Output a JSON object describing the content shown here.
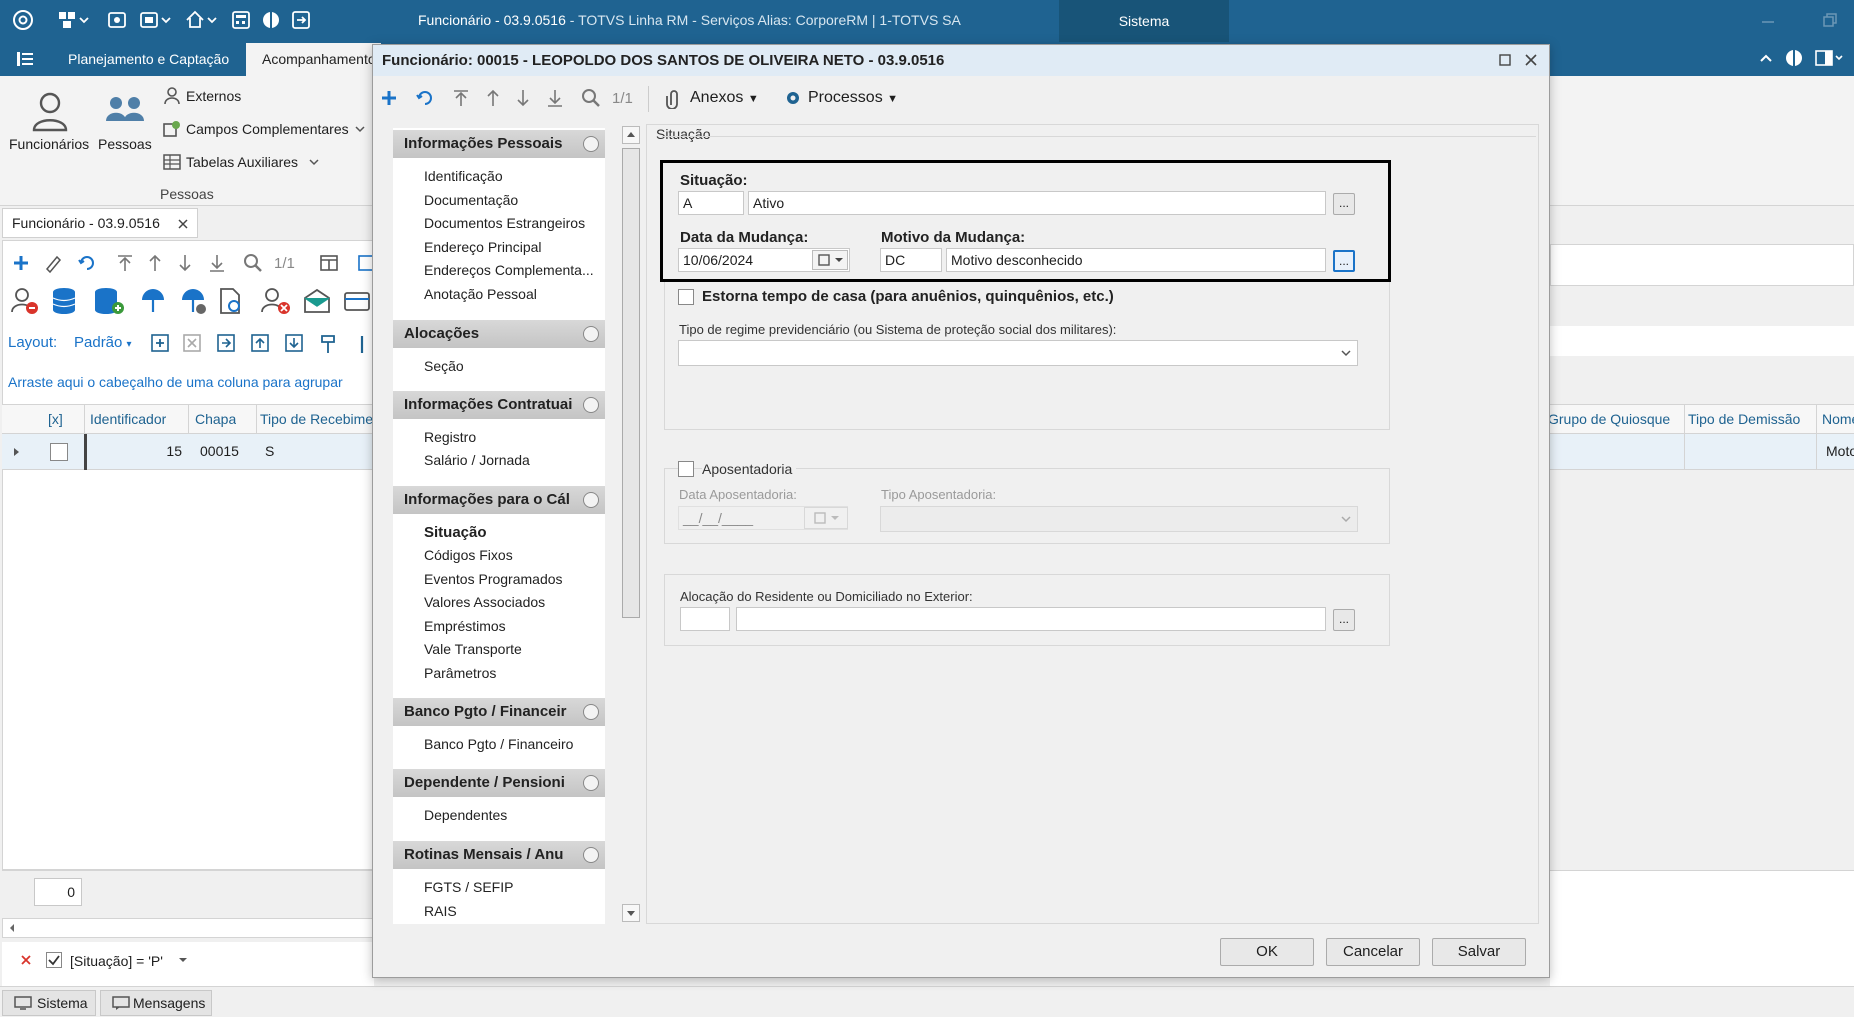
{
  "window": {
    "title_main": "Funcionário - 03.9.0516",
    "title_rest": " - TOTVS Linha RM - Serviços  Alias: CorporeRM | 1-TOTVS SA",
    "sistema_tab": "Sistema"
  },
  "menu": {
    "tabs": [
      "Planejamento e Captação",
      "Acompanhamento"
    ]
  },
  "ribbon": {
    "funcionarios": "Funcionários",
    "pessoas": "Pessoas",
    "externos": "Externos",
    "campos_complementares": "Campos Complementares",
    "tabelas_auxiliares": "Tabelas Auxiliares",
    "group_label": "Pessoas"
  },
  "doc_tab": {
    "label": "Funcionário - 03.9.0516"
  },
  "list_toolbar": {
    "page": "1/1",
    "layout_label": "Layout:",
    "layout_value": "Padrão"
  },
  "group_hint": "Arraste aqui o cabeçalho de uma coluna para agrupar",
  "grid": {
    "columns": [
      "[x]",
      "Identificador",
      "Chapa",
      "Tipo de Recebime",
      "Grupo de Quiosque",
      "Tipo de Demissão",
      "Nome"
    ],
    "row": {
      "identificador": "15",
      "chapa": "00015",
      "tipo": "S",
      "nome": "Moto"
    }
  },
  "count_box": "0",
  "filter": {
    "text": "[Situação] = 'P'"
  },
  "statusbar": {
    "sistema": "Sistema",
    "mensagens": "Mensagens"
  },
  "dialog": {
    "title": "Funcionário: 00015 - LEOPOLDO DOS SANTOS DE OLIVEIRA NETO - 03.9.0516",
    "toolbar": {
      "page": "1/1",
      "anexos": "Anexos",
      "processos": "Processos"
    },
    "nav": [
      {
        "header": "Informações Pessoais",
        "items": [
          "Identificação",
          "Documentação",
          "Documentos Estrangeiros",
          "Endereço Principal",
          "Endereços Complementa...",
          "Anotação Pessoal"
        ]
      },
      {
        "header": "Alocações",
        "items": [
          "Seção"
        ]
      },
      {
        "header": "Informações Contratuai",
        "items": [
          "Registro",
          "Salário / Jornada"
        ]
      },
      {
        "header": "Informações para o Cál",
        "items": [
          "Situação",
          "Códigos Fixos",
          "Eventos Programados",
          "Valores Associados",
          "Empréstimos",
          "Vale Transporte",
          "Parâmetros"
        ]
      },
      {
        "header": "Banco Pgto / Financeir",
        "items": [
          "Banco Pgto / Financeiro"
        ]
      },
      {
        "header": "Dependente / Pensioni",
        "items": [
          "Dependentes"
        ]
      },
      {
        "header": "Rotinas Mensais / Anu",
        "items": [
          "FGTS / SEFIP",
          "RAIS"
        ]
      }
    ],
    "section_title": "Situação",
    "situacao": {
      "label": "Situação:",
      "code": "A",
      "desc": "Ativo"
    },
    "data_mudanca": {
      "label": "Data da Mudança:",
      "value": "10/06/2024"
    },
    "motivo": {
      "label": "Motivo da Mudança:",
      "code": "DC",
      "desc": "Motivo desconhecido"
    },
    "estorna": {
      "label": "Estorna tempo de casa (para anuênios, quinquênios, etc.)"
    },
    "regime": {
      "label": "Tipo de regime previdenciário (ou Sistema de proteção social dos militares):",
      "value": ""
    },
    "aposentadoria": {
      "label": "Aposentadoria",
      "data_label": "Data Aposentadoria:",
      "data_value": "__/__/____",
      "tipo_label": "Tipo Aposentadoria:"
    },
    "alocacao": {
      "label": "Alocação do Residente ou Domiciliado no Exterior:"
    },
    "ellipsis": "...",
    "buttons": {
      "ok": "OK",
      "cancelar": "Cancelar",
      "salvar": "Salvar"
    }
  }
}
